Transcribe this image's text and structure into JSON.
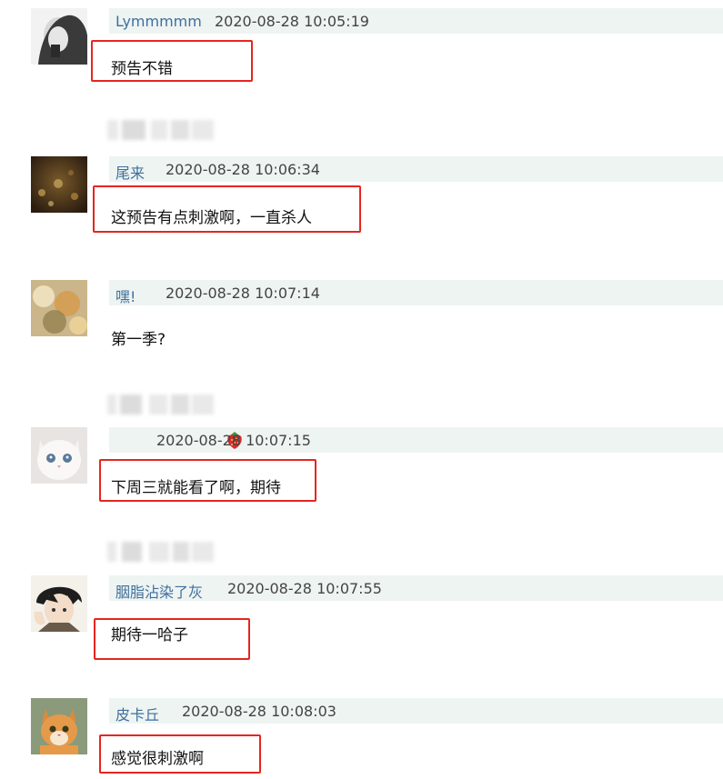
{
  "comments": [
    {
      "user": "Lymmmmm",
      "time": "2020-08-28 10:05:19",
      "text": "预告不错",
      "avatar_icon": "avatar-portrait-bw-icon"
    },
    {
      "user": "尾来",
      "time": "2020-08-28 10:06:34",
      "text": "这预告有点刺激啊，一直杀人",
      "avatar_icon": "avatar-golden-bokeh-icon"
    },
    {
      "user": "嘿!",
      "time": "2020-08-28 10:07:14",
      "text": "第一季?",
      "avatar_icon": "avatar-floral-painting-icon"
    },
    {
      "user": "",
      "user_icon": "strawberry-icon",
      "time": "2020-08-28 10:07:15",
      "text": "下周三就能看了啊，期待",
      "avatar_icon": "avatar-white-kitten-icon"
    },
    {
      "user": "胭脂沾染了灰",
      "time": "2020-08-28 10:07:55",
      "text": "期待一哈子",
      "avatar_icon": "avatar-anime-boy-icon"
    },
    {
      "user": "皮卡丘",
      "time": "2020-08-28 10:08:03",
      "text": "感觉很刺激啊",
      "avatar_icon": "avatar-orange-cat-icon"
    }
  ],
  "colors": {
    "meta_bg": "#eef4f2",
    "username": "#3f6f9d",
    "highlight_border": "#e5261f",
    "text": "#111111"
  }
}
